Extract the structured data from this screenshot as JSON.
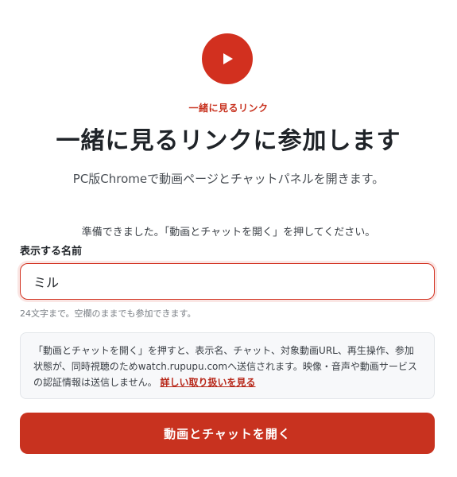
{
  "brand": {
    "accent": "#d2301f",
    "icon": "play-icon"
  },
  "eyebrow": "一緒に見るリンク",
  "title": "一緒に見るリンクに参加します",
  "subtitle": "PC版Chromeで動画ページとチャットパネルを開きます。",
  "status": "準備できました。「動画とチャットを開く」を押してください。",
  "form": {
    "name_label": "表示する名前",
    "name_value": "ミル",
    "hint": "24文字まで。空欄のままでも参加できます。"
  },
  "notice": {
    "text": "「動画とチャットを開く」を押すと、表示名、チャット、対象動画URL、再生操作、参加状態が、同時視聴のためwatch.rupupu.comへ送信されます。映像・音声や動画サービスの認証情報は送信しません。",
    "link_label": "詳しい取り扱いを見る"
  },
  "submit_label": "動画とチャットを開く"
}
